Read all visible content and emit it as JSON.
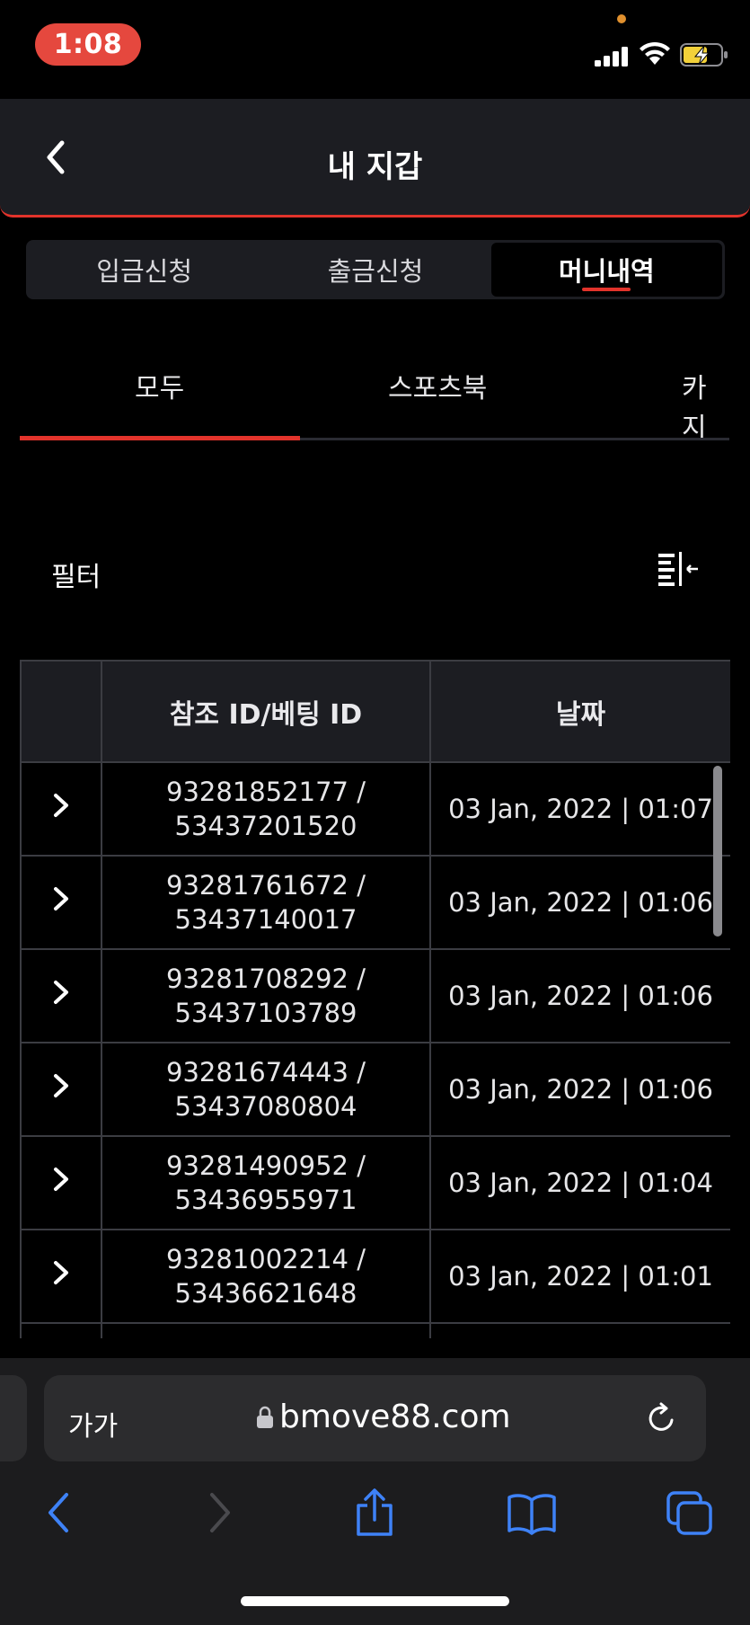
{
  "status_bar": {
    "time": "1:08"
  },
  "header": {
    "title": "내 지갑"
  },
  "segments": [
    {
      "label": "입금신청"
    },
    {
      "label": "출금신청"
    },
    {
      "label": "머니내역"
    }
  ],
  "category_tabs": [
    {
      "label": "모두"
    },
    {
      "label": "스포츠북"
    },
    {
      "label": "카지"
    }
  ],
  "filter": {
    "label": "필터"
  },
  "table": {
    "headers": [
      "",
      "참조 ID/베팅 ID",
      "날짜"
    ],
    "rows": [
      {
        "ref_line1": "93281852177 /",
        "ref_line2": "53437201520",
        "date": "03 Jan, 2022 | 01:07"
      },
      {
        "ref_line1": "93281761672 /",
        "ref_line2": "53437140017",
        "date": "03 Jan, 2022 | 01:06"
      },
      {
        "ref_line1": "93281708292 /",
        "ref_line2": "53437103789",
        "date": "03 Jan, 2022 | 01:06"
      },
      {
        "ref_line1": "93281674443 /",
        "ref_line2": "53437080804",
        "date": "03 Jan, 2022 | 01:06"
      },
      {
        "ref_line1": "93281490952 /",
        "ref_line2": "53436955971",
        "date": "03 Jan, 2022 | 01:04"
      },
      {
        "ref_line1": "93281002214 /",
        "ref_line2": "53436621648",
        "date": "03 Jan, 2022 | 01:01"
      }
    ]
  },
  "browser": {
    "text_size_label": "가가",
    "url": "bmove88.com"
  },
  "colors": {
    "accent": "#e2332b",
    "ios_blue": "#3e82f7",
    "panel": "#1c1d22"
  }
}
